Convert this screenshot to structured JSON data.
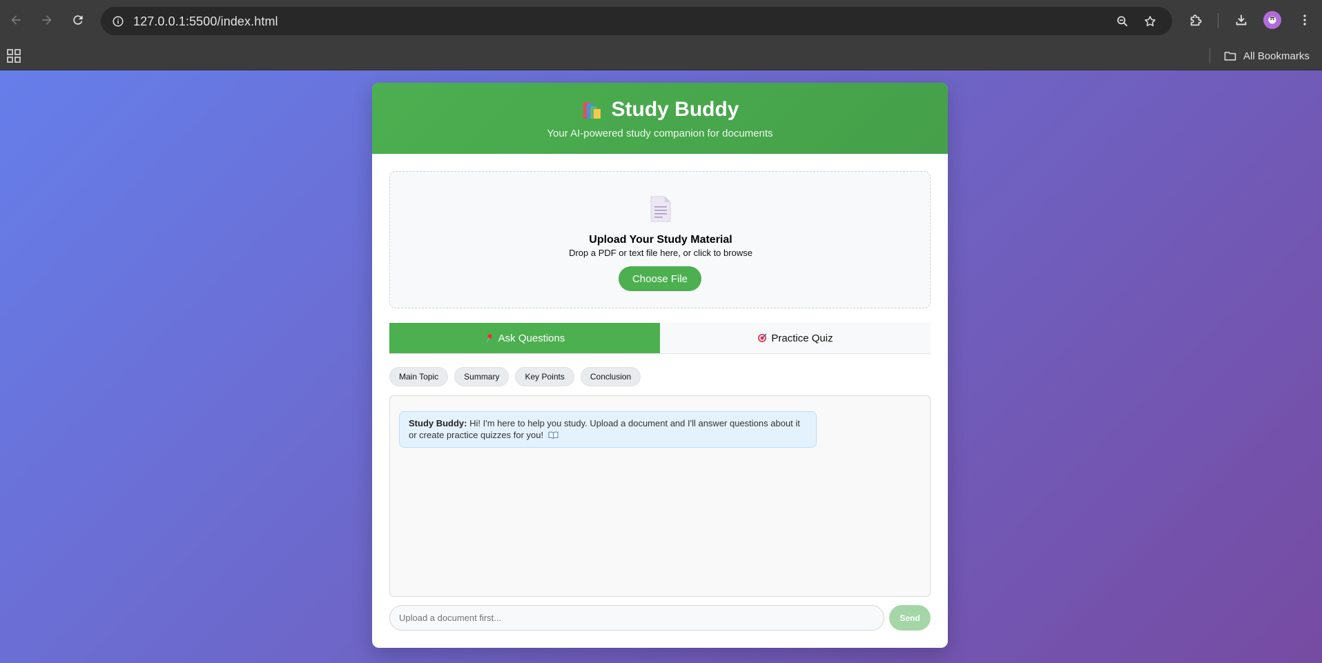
{
  "browser": {
    "url": "127.0.0.1:5500/index.html",
    "bookmarks_label": "All Bookmarks",
    "icons": [
      "back-arrow-icon",
      "forward-arrow-icon",
      "reload-icon",
      "site-info-icon",
      "zoom-icon",
      "bookmark-star-icon",
      "extensions-icon",
      "download-icon",
      "profile-avatar-icon",
      "apps-grid-icon",
      "folder-icon"
    ]
  },
  "header": {
    "icon": "books-icon",
    "title": "Study Buddy",
    "subtitle": "Your AI-powered study companion for documents"
  },
  "upload": {
    "icon": "document-icon",
    "title": "Upload Your Study Material",
    "hint": "Drop a PDF or text file here, or click to browse",
    "button_label": "Choose File"
  },
  "tabs": [
    {
      "label": "Ask Questions",
      "icon": "pin-icon",
      "active": true
    },
    {
      "label": "Practice Quiz",
      "icon": "target-icon",
      "active": false
    }
  ],
  "quick_prompts": [
    "Main Topic",
    "Summary",
    "Key Points",
    "Conclusion"
  ],
  "chat": {
    "messages": [
      {
        "sender": "Study Buddy:",
        "text": "Hi! I'm here to help you study. Upload a document and I'll answer questions about it or create practice quizzes for you!",
        "icon": "open-book-icon"
      }
    ]
  },
  "composer": {
    "placeholder": "Upload a document first...",
    "send_label": "Send",
    "send_enabled": false
  },
  "colors": {
    "primary_green": "#4caf50",
    "disabled_green": "#a5d6a7",
    "bubble_bg": "#e3f2fd",
    "gradient_start": "#667eea",
    "gradient_end": "#764ba2"
  }
}
